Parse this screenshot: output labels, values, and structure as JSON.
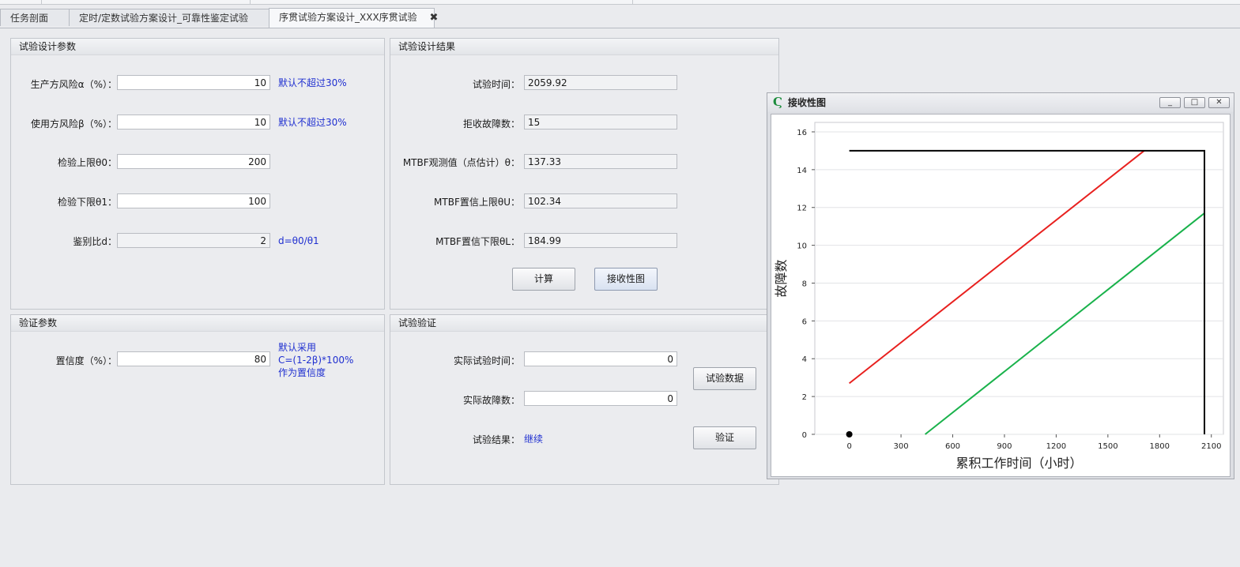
{
  "tabs": [
    {
      "label": "任务剖面"
    },
    {
      "label": "定时/定数试验方案设计_可靠性鉴定试验"
    },
    {
      "label": "序贯试验方案设计_XXX序贯试验",
      "close": "✖"
    }
  ],
  "design_params": {
    "title": "试验设计参数",
    "alpha": {
      "label": "生产方风险α（%）：",
      "value": "10",
      "note": "默认不超过30%"
    },
    "beta": {
      "label": "使用方风险β（%）：",
      "value": "10",
      "note": "默认不超过30%"
    },
    "theta0": {
      "label": "检验上限θ0：",
      "value": "200"
    },
    "theta1": {
      "label": "检验下限θ1：",
      "value": "100"
    },
    "ratio": {
      "label": "鉴别比d：",
      "value": "2",
      "note": "d=θ0/θ1"
    }
  },
  "design_results": {
    "title": "试验设计结果",
    "test_time": {
      "label": "试验时间：",
      "value": "2059.92"
    },
    "reject_failures": {
      "label": "拒收故障数：",
      "value": "15"
    },
    "mtbf_point": {
      "label": "MTBF观测值（点估计）θ：",
      "value": "137.33"
    },
    "mtbf_upper": {
      "label": "MTBF置信上限θU：",
      "value": "102.34"
    },
    "mtbf_lower": {
      "label": "MTBF置信下限θL：",
      "value": "184.99"
    },
    "calc_button": "计算",
    "chart_button": "接收性图"
  },
  "verify_params": {
    "title": "验证参数",
    "confidence": {
      "label": "置信度（%）：",
      "value": "80"
    },
    "note_lines": [
      "默认采用",
      "C=(1-2β)*100%",
      "作为置信度"
    ]
  },
  "test_verify": {
    "title": "试验验证",
    "actual_time": {
      "label": "实际试验时间：",
      "value": "0"
    },
    "actual_failures": {
      "label": "实际故障数：",
      "value": "0"
    },
    "result": {
      "label": "试验结果：",
      "value": "继续"
    },
    "data_button": "试验数据",
    "verify_button": "验证"
  },
  "chart_window": {
    "title": "接收性图",
    "controls": {
      "minimize": "_",
      "maximize": "□",
      "close": "✕"
    }
  },
  "colors": {
    "reject_line": "#e8201e",
    "accept_line": "#19b24b",
    "boundary": "#000000",
    "note_text": "#1f2fd0"
  },
  "chart_data": {
    "type": "line",
    "xlabel": "累积工作时间（小时）",
    "ylabel": "故障数",
    "xlim": [
      -200,
      2170
    ],
    "ylim": [
      0,
      16.5
    ],
    "xticks": [
      0,
      300,
      600,
      900,
      1200,
      1500,
      1800,
      2100
    ],
    "yticks": [
      0,
      2,
      4,
      6,
      8,
      10,
      12,
      14,
      16
    ],
    "grid": "horizontal",
    "series": [
      {
        "color": "#e8201e",
        "points": [
          [
            0,
            2.7
          ],
          [
            1710,
            15
          ]
        ]
      },
      {
        "color": "#19b24b",
        "points": [
          [
            440,
            0
          ],
          [
            2060,
            11.7
          ]
        ]
      },
      {
        "color": "#000000",
        "points": [
          [
            0,
            15
          ],
          [
            2060,
            15
          ],
          [
            2060,
            0
          ]
        ]
      }
    ],
    "current_point": [
      0,
      0
    ]
  }
}
